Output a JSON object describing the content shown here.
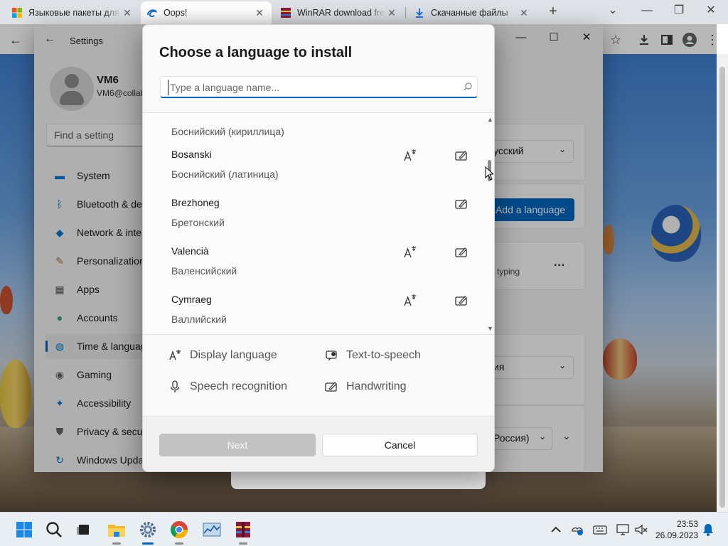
{
  "browser": {
    "tabs": [
      {
        "title": "Языковые пакеты для",
        "icon": "windows-logo-icon",
        "active": false
      },
      {
        "title": "Oops!",
        "icon": "edge-swirl-icon",
        "active": true
      },
      {
        "title": "WinRAR download free",
        "icon": "winrar-icon",
        "active": false
      },
      {
        "title": "Скачанные файлы",
        "icon": "download-icon",
        "active": false
      }
    ],
    "new_tab_glyph": "+",
    "toolbar": {
      "back_glyph": "←"
    }
  },
  "settings": {
    "window_title": "Settings",
    "user": {
      "name": "VM6",
      "email": "VM6@collab"
    },
    "search_placeholder": "Find a setting",
    "nav": [
      {
        "label": "System",
        "icon": "monitor-icon",
        "color": "#0078d4"
      },
      {
        "label": "Bluetooth & de",
        "icon": "bluetooth-icon",
        "color": "#0078d4"
      },
      {
        "label": "Network & inte",
        "icon": "wifi-icon",
        "color": "#0078d4"
      },
      {
        "label": "Personalization",
        "icon": "brush-icon",
        "color": "#c46b2b"
      },
      {
        "label": "Apps",
        "icon": "apps-icon",
        "color": "#555555"
      },
      {
        "label": "Accounts",
        "icon": "person-icon",
        "color": "#2aa876"
      },
      {
        "label": "Time & languag",
        "icon": "globe-clock-icon",
        "color": "#0078d4",
        "selected": true
      },
      {
        "label": "Gaming",
        "icon": "gamepad-icon",
        "color": "#666666"
      },
      {
        "label": "Accessibility",
        "icon": "accessibility-icon",
        "color": "#0078d4"
      },
      {
        "label": "Privacy & secur",
        "icon": "shield-icon",
        "color": "#666666"
      },
      {
        "label": "Windows Upda",
        "icon": "update-icon",
        "color": "#0078d4"
      }
    ],
    "right": {
      "dropdown1": "усский",
      "add_language": "Add a language",
      "typing_text": "typing",
      "more_glyph": "···",
      "dropdown2": "ия",
      "dropdown3": "Россия)"
    }
  },
  "dialog": {
    "title": "Choose a language to install",
    "search_placeholder": "Type a language name...",
    "search_value": "",
    "languages": [
      {
        "native": "",
        "localized": "Боснийский (кириллица)",
        "display": false,
        "handwriting": false
      },
      {
        "native": "Bosanski",
        "localized": "Боснийский (латиница)",
        "display": true,
        "handwriting": true
      },
      {
        "native": "Brezhoneg",
        "localized": "Бретонский",
        "display": false,
        "handwriting": true
      },
      {
        "native": "Valencià",
        "localized": "Валенсийский",
        "display": true,
        "handwriting": true
      },
      {
        "native": "Cymraeg",
        "localized": "Валлийский",
        "display": true,
        "handwriting": true
      }
    ],
    "legend": [
      {
        "label": "Display language",
        "icon": "display-language-icon"
      },
      {
        "label": "Text-to-speech",
        "icon": "text-to-speech-icon"
      },
      {
        "label": "Speech recognition",
        "icon": "microphone-icon"
      },
      {
        "label": "Handwriting",
        "icon": "handwriting-icon"
      }
    ],
    "next_label": "Next",
    "cancel_label": "Cancel"
  },
  "taskbar": {
    "time": "23:53",
    "date": "26.09.2023"
  }
}
